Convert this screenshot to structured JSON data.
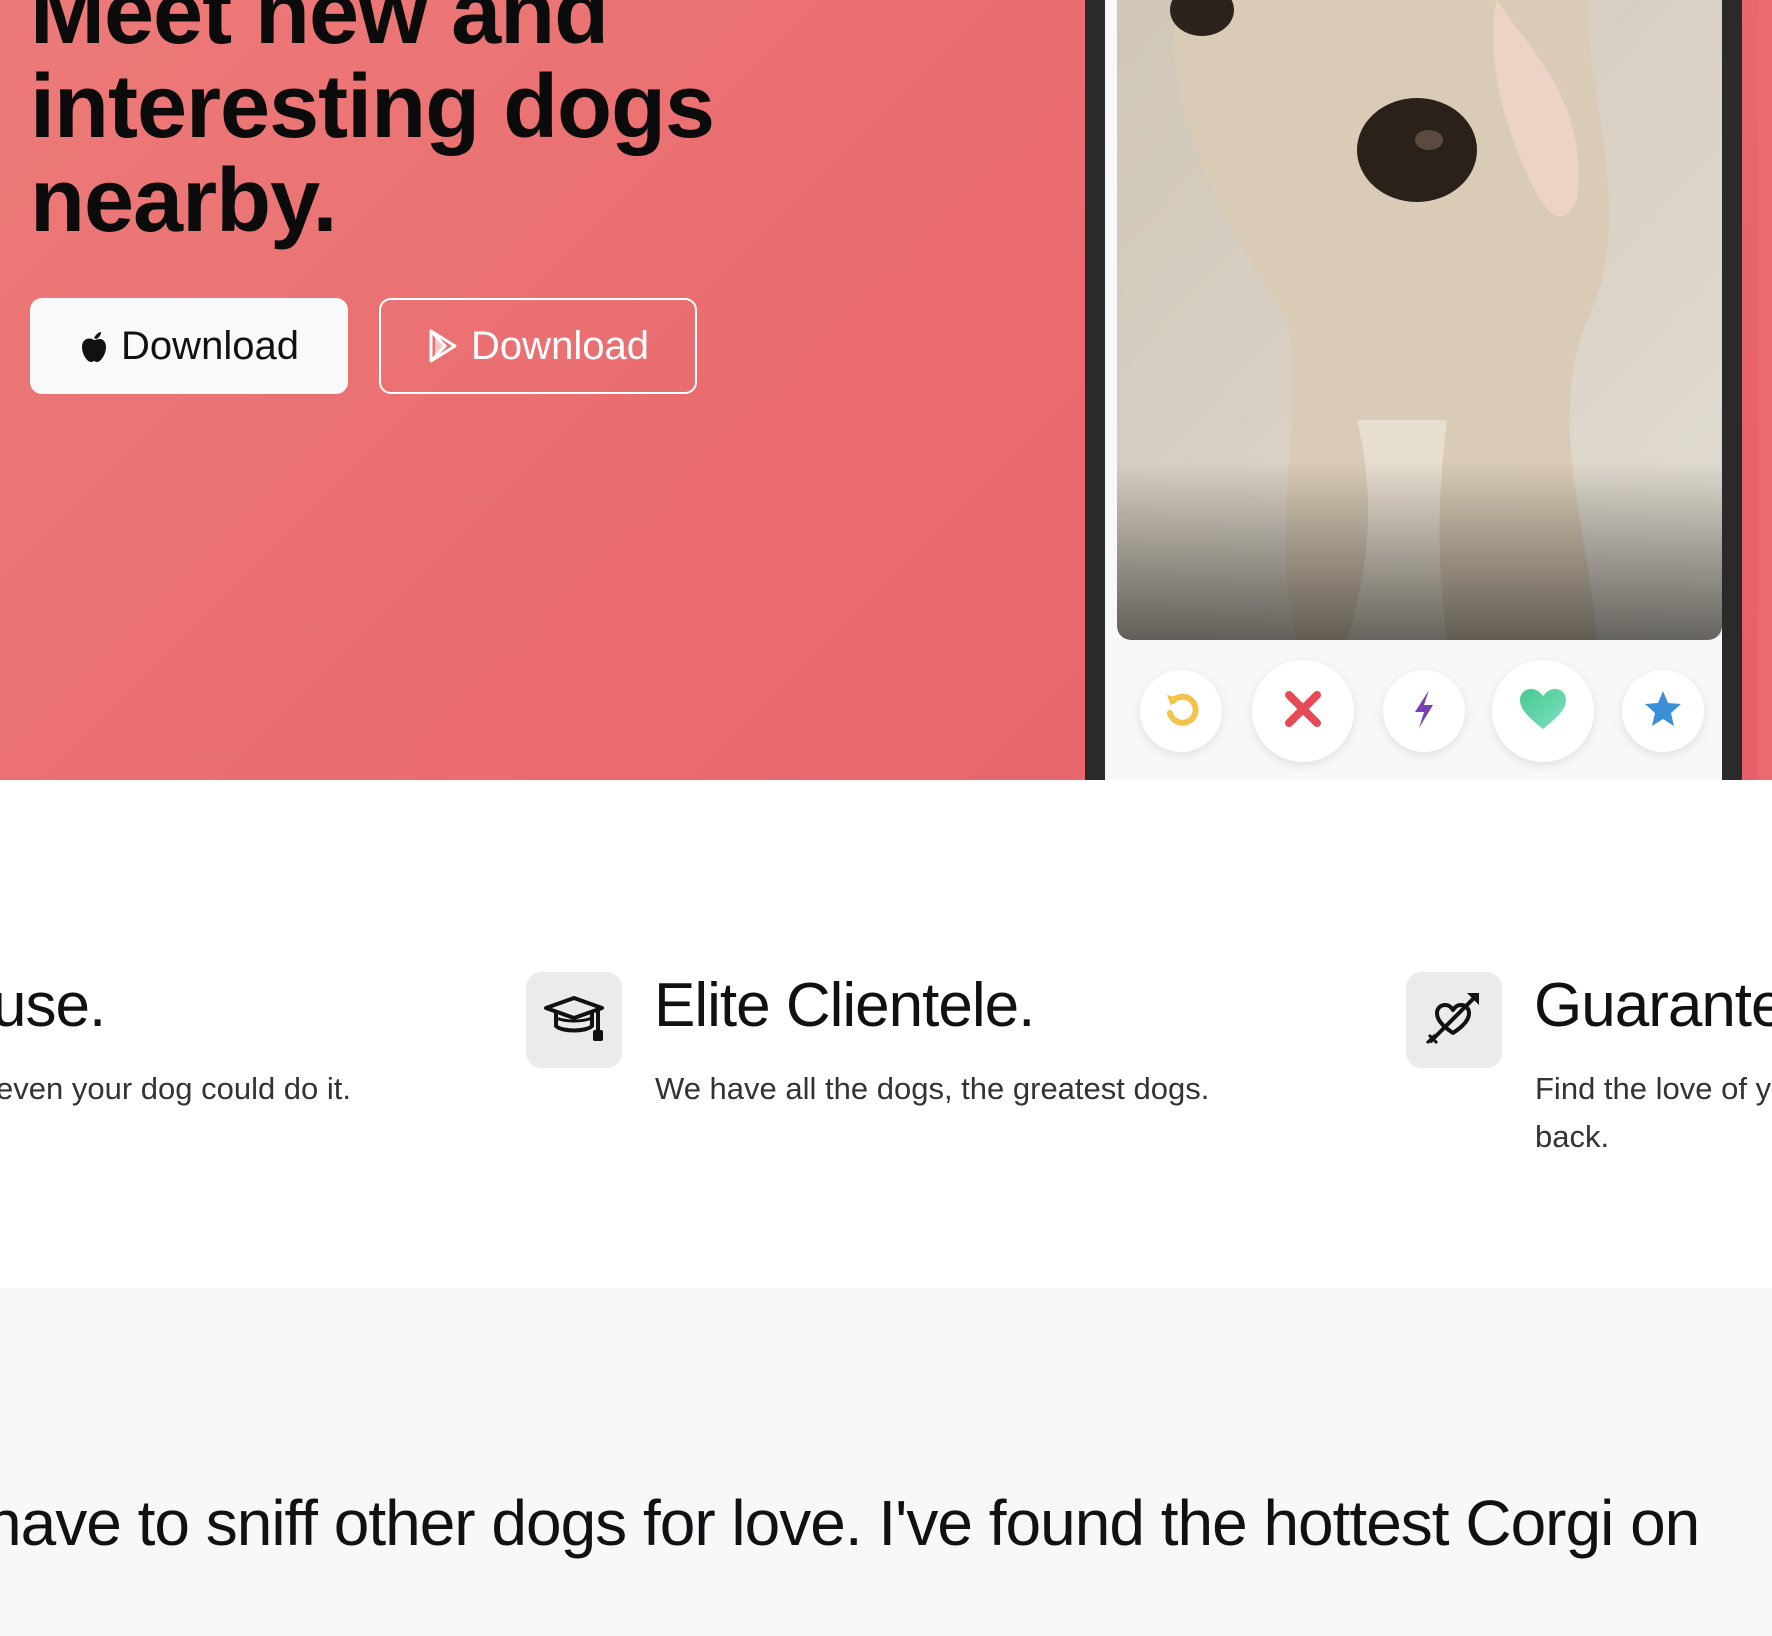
{
  "hero": {
    "title_lines": [
      "Meet new and",
      "interesting dogs",
      "nearby."
    ],
    "apple_button_label": "Download",
    "play_button_label": "Download",
    "background_color": "#ea6a6e"
  },
  "app_preview": {
    "action_buttons": [
      "rewind-icon",
      "close-icon",
      "lightning-icon",
      "heart-icon",
      "star-icon"
    ],
    "colors": {
      "rewind": "#f2c44b",
      "nope": "#e64a55",
      "boost": "#7b3fb5",
      "like": "#5ccfa0",
      "superlike": "#3a8fd9"
    }
  },
  "features": [
    {
      "icon": "",
      "title": "use.",
      "text_lines": [
        "even your dog could do it."
      ]
    },
    {
      "icon": "graduation-cap-icon",
      "title": "Elite Clientele.",
      "text_lines": [
        "We have all the dogs, the greatest dogs."
      ]
    },
    {
      "icon": "heart-arrow-icon",
      "title": "Guarante",
      "text_lines": [
        "Find the love of y",
        "back."
      ]
    }
  ],
  "testimonial": {
    "quote": "have to sniff other dogs for love. I've found the hottest Corgi on"
  }
}
